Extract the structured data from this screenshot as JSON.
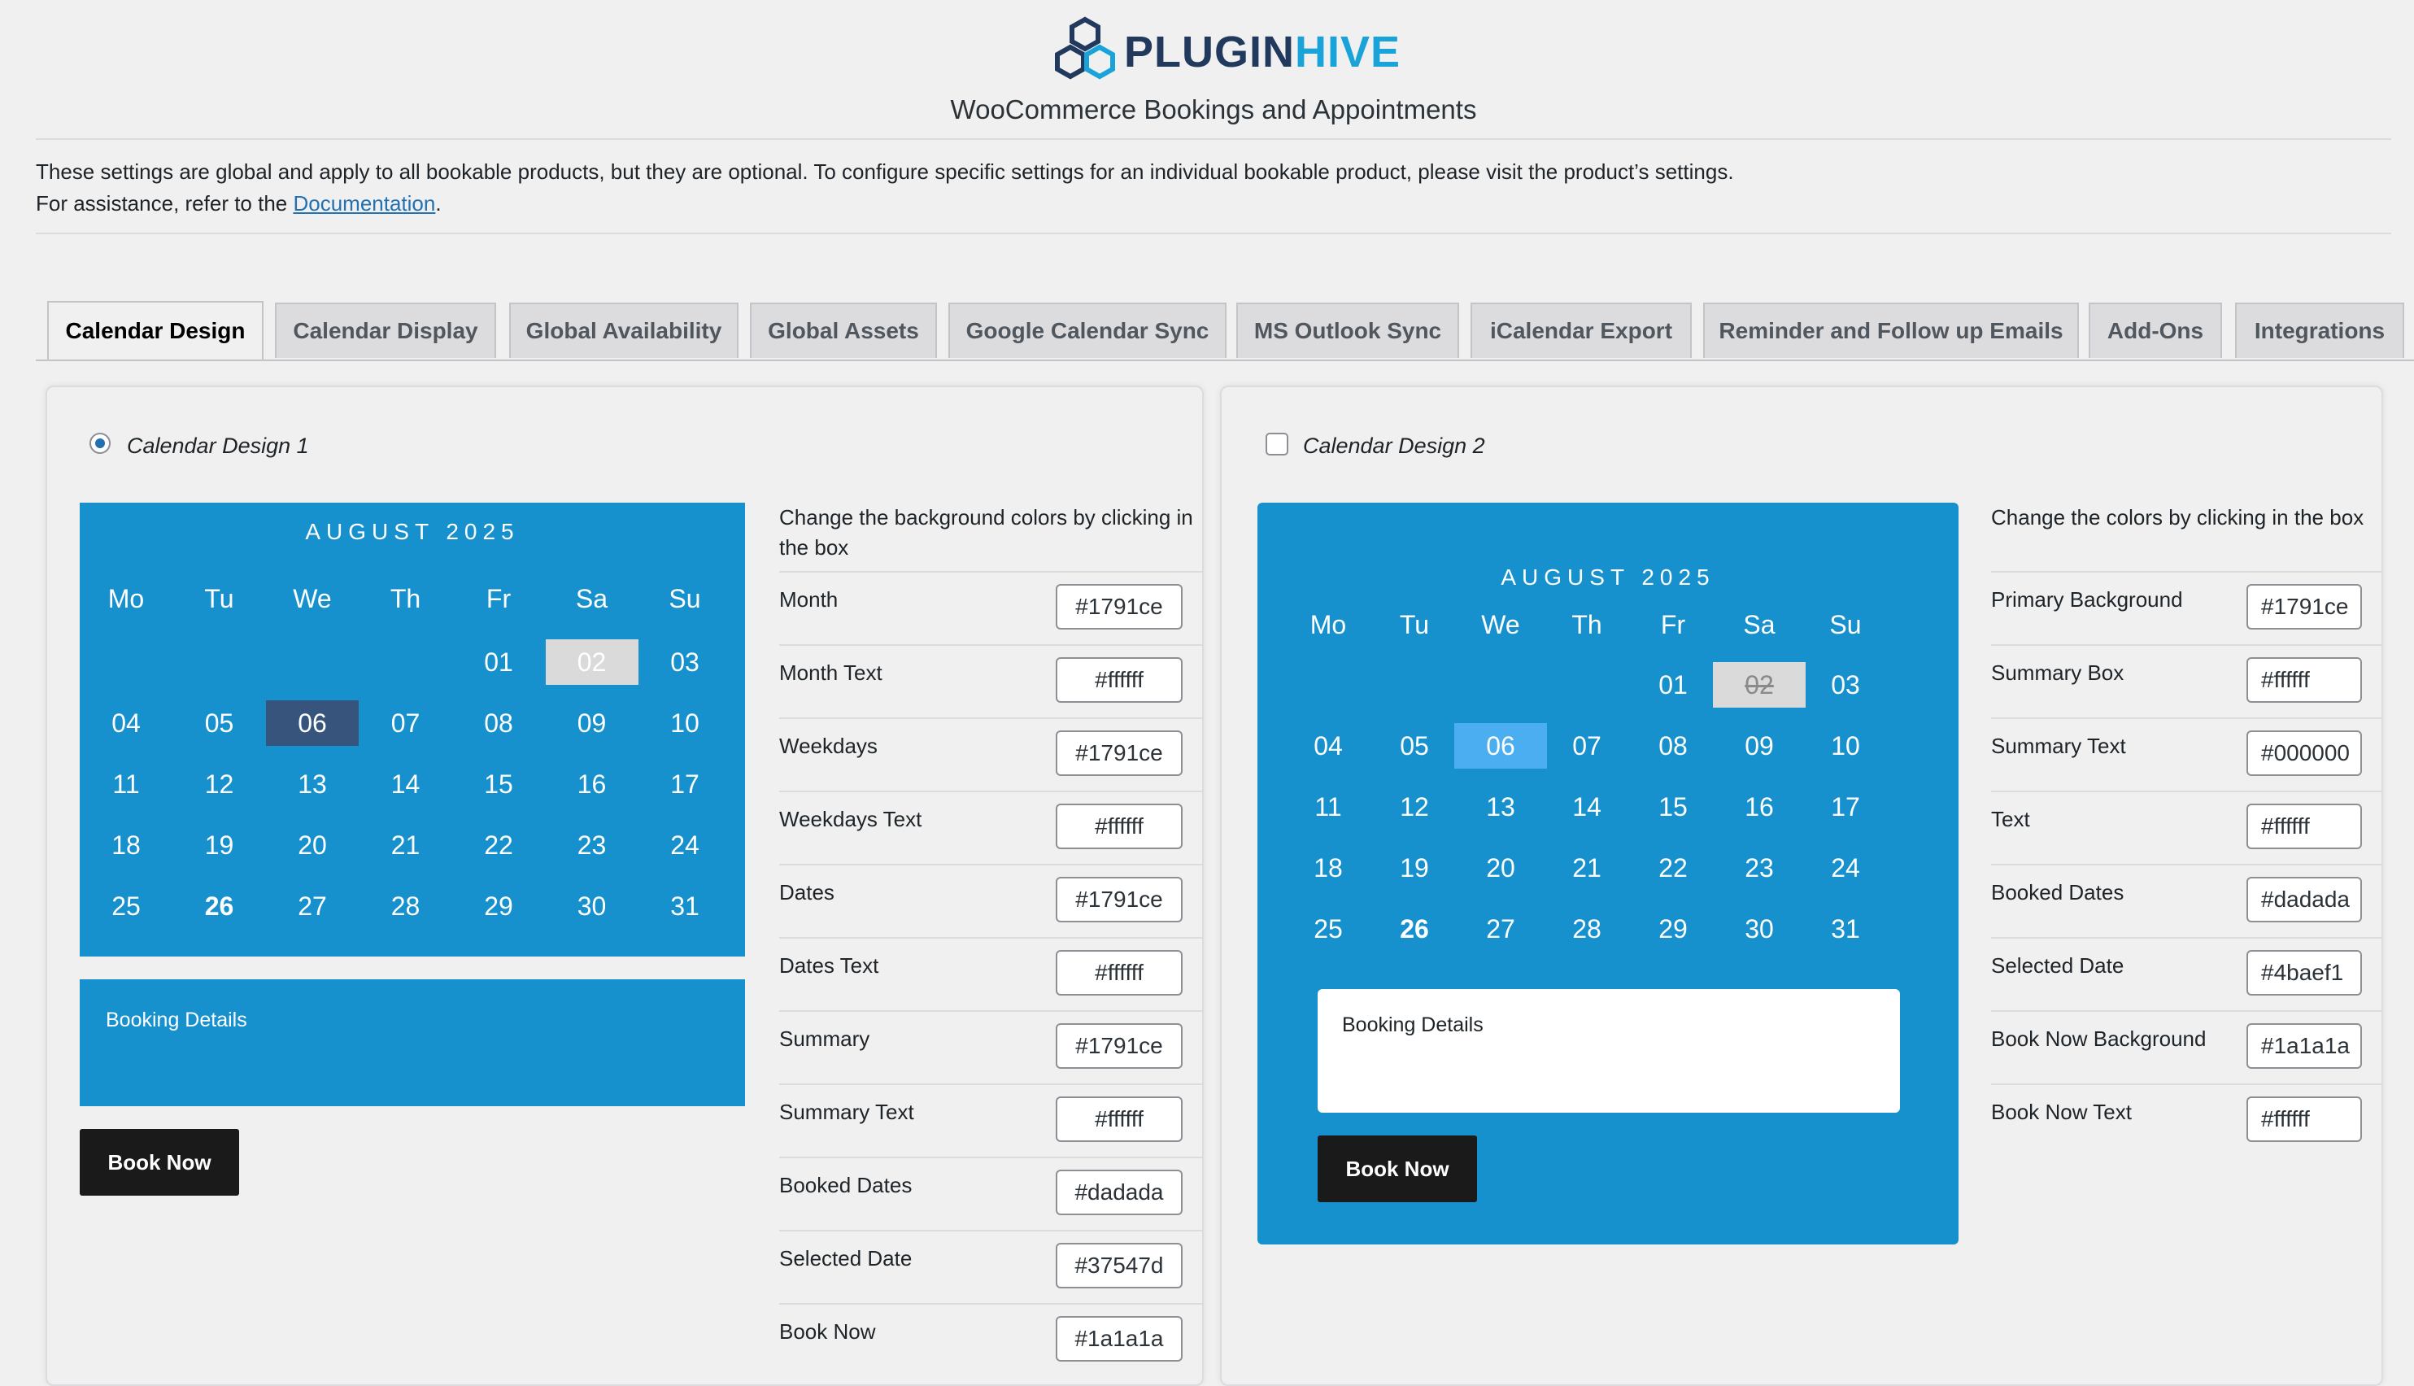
{
  "header": {
    "logo_text_1": "PLUGIN",
    "logo_text_2": "HIVE",
    "plugin_title": "WooCommerce Bookings and Appointments",
    "intro_line1": "These settings are global and apply to all bookable products, but they are optional. To configure specific settings for an individual bookable product, please visit the product’s settings.",
    "intro_line2_prefix": "For assistance, refer to the ",
    "doc_link": "Documentation",
    "intro_line2_suffix": "."
  },
  "tabs": [
    {
      "label": "Calendar Design",
      "active": true
    },
    {
      "label": "Calendar Display"
    },
    {
      "label": "Global Availability"
    },
    {
      "label": "Global Assets"
    },
    {
      "label": "Google Calendar Sync"
    },
    {
      "label": "MS Outlook Sync"
    },
    {
      "label": "iCalendar Export"
    },
    {
      "label": "Reminder and Follow up Emails"
    },
    {
      "label": "Add-Ons"
    },
    {
      "label": "Integrations"
    }
  ],
  "calendar": {
    "month": "AUGUST 2025",
    "weekdays": [
      "Mo",
      "Tu",
      "We",
      "Th",
      "Fr",
      "Sa",
      "Su"
    ],
    "weeks": [
      [
        "",
        "",
        "",
        "",
        "01",
        "02",
        "03"
      ],
      [
        "04",
        "05",
        "06",
        "07",
        "08",
        "09",
        "10"
      ],
      [
        "11",
        "12",
        "13",
        "14",
        "15",
        "16",
        "17"
      ],
      [
        "18",
        "19",
        "20",
        "21",
        "22",
        "23",
        "24"
      ],
      [
        "25",
        "26",
        "27",
        "28",
        "29",
        "30",
        "31"
      ]
    ],
    "booked_day": "02",
    "selected_day": "06",
    "today_day": "26"
  },
  "design1": {
    "label": "Calendar Design 1",
    "selected": true,
    "booking_details": "Booking Details",
    "book_now": "Book Now",
    "settings_title": "Change the background colors by clicking in the box",
    "settings": [
      {
        "label": "Month",
        "value": "#1791ce"
      },
      {
        "label": "Month Text",
        "value": "#ffffff"
      },
      {
        "label": "Weekdays",
        "value": "#1791ce"
      },
      {
        "label": "Weekdays Text",
        "value": "#ffffff"
      },
      {
        "label": "Dates",
        "value": "#1791ce"
      },
      {
        "label": "Dates Text",
        "value": "#ffffff"
      },
      {
        "label": "Summary",
        "value": "#1791ce"
      },
      {
        "label": "Summary Text",
        "value": "#ffffff"
      },
      {
        "label": "Booked Dates",
        "value": "#dadada"
      },
      {
        "label": "Selected Date",
        "value": "#37547d"
      },
      {
        "label": "Book Now",
        "value": "#1a1a1a"
      }
    ]
  },
  "design2": {
    "label": "Calendar Design 2",
    "selected": false,
    "booking_details": "Booking Details",
    "book_now": "Book Now",
    "settings_title": "Change the colors by clicking in the box",
    "settings": [
      {
        "label": "Primary Background",
        "value": "#1791ce"
      },
      {
        "label": "Summary Box",
        "value": "#ffffff"
      },
      {
        "label": "Summary Text",
        "value": "#000000"
      },
      {
        "label": "Text",
        "value": "#ffffff"
      },
      {
        "label": "Booked Dates",
        "value": "#dadada"
      },
      {
        "label": "Selected Date",
        "value": "#4baef1"
      },
      {
        "label": "Book Now Background",
        "value": "#1a1a1a"
      },
      {
        "label": "Book Now Text",
        "value": "#ffffff"
      }
    ]
  },
  "colors": {
    "calendar_blue": "#1791ce",
    "design1_selected": "#37547d",
    "design2_selected": "#4baef1",
    "booked": "#dadada",
    "button": "#1a1a1a",
    "link": "#2271b1"
  }
}
